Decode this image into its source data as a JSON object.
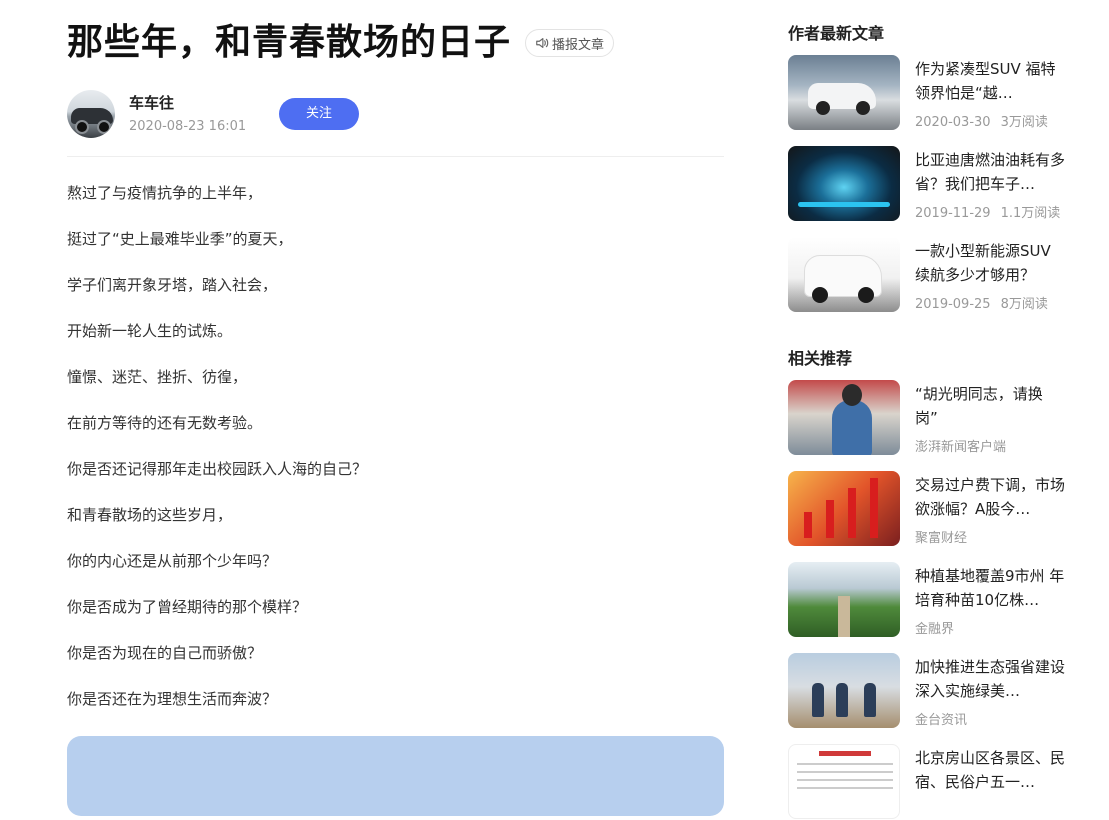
{
  "article": {
    "title": "那些年，和青春散场的日子",
    "listen_label": "播报文章",
    "author": {
      "name": "车车往",
      "date": "2020-08-23 16:01",
      "follow_label": "关注"
    },
    "paragraphs": [
      "熬过了与疫情抗争的上半年，",
      "挺过了“史上最难毕业季”的夏天，",
      "学子们离开象牙塔，踏入社会，",
      "开始新一轮人生的试炼。",
      "憧憬、迷茫、挫折、彷徨，",
      "在前方等待的还有无数考验。",
      "你是否还记得那年走出校园跃入人海的自己？",
      "和青春散场的这些岁月，",
      "你的内心还是从前那个少年吗？",
      "你是否成为了曾经期待的那个模样？",
      "你是否为现在的自己而骄傲？",
      "你是否还在为理想生活而奔波？"
    ]
  },
  "sidebar": {
    "author_section_title": "作者最新文章",
    "author_articles": [
      {
        "title": "作为紧凑型SUV 福特领界怕是“越…",
        "date": "2020-03-30",
        "reads": "3万阅读",
        "thumb": "white-suv-photo"
      },
      {
        "title": "比亚迪唐燃油油耗有多省？我们把车子…",
        "date": "2019-11-29",
        "reads": "1.1万阅读",
        "thumb": "digital-dashboard-photo"
      },
      {
        "title": "一款小型新能源SUV续航多少才够用？",
        "date": "2019-09-25",
        "reads": "8万阅读",
        "thumb": "white-ev-suv-photo"
      }
    ],
    "related_section_title": "相关推荐",
    "related_articles": [
      {
        "title": "“胡光明同志，请换岗”",
        "source": "澎湃新闻客户端",
        "thumb": "speech-photo"
      },
      {
        "title": "交易过户费下调，市场欲涨幅？A股今…",
        "source": "聚富财经",
        "thumb": "stock-arrows-photo"
      },
      {
        "title": "种植基地覆盖9市州 年培育种苗10亿株…",
        "source": "金融界",
        "thumb": "greenhouse-photo"
      },
      {
        "title": "加快推进生态强省建设 深入实施绿美…",
        "source": "金台资讯",
        "thumb": "tree-planting-photo"
      },
      {
        "title": "北京房山区各景区、民宿、民俗户五一…",
        "source": "",
        "thumb": "document-photo"
      }
    ]
  },
  "colors": {
    "follow_button": "#4e6ef2",
    "image_placeholder": "#b7cfee"
  }
}
